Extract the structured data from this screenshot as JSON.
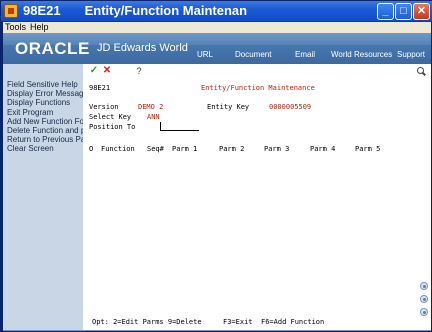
{
  "window": {
    "program": "98E21",
    "title": "Entity/Function Maintenan",
    "minimize": "_",
    "maximize": "□",
    "close": "✕"
  },
  "menubar": {
    "tools": "Tools",
    "help": "Help"
  },
  "banner": {
    "logo": "ORACLE",
    "product": "JD Edwards World",
    "links": [
      "URL",
      "Document",
      "Email",
      "World Resources",
      "Support"
    ]
  },
  "sidebar": {
    "items": [
      "Field Sensitive Help",
      "Display Error Message",
      "Display Functions",
      "Exit Program",
      "Add New Function For E",
      "Delete Function and par",
      "Return to Previous Pane",
      "Clear Screen"
    ]
  },
  "toolbar": {
    "ok": "✓",
    "cancel": "✕",
    "help": "?"
  },
  "form": {
    "program_id": "98E21",
    "heading": "Entity/Function Maintenance",
    "version_label": "Version",
    "version_value": "DEMO 2",
    "entity_key_label": "Entity Key",
    "entity_key_value": "0000005509",
    "select_key_label": "Select Key",
    "select_key_value": "ANN",
    "position_to_label": "Position To",
    "position_to_value": ""
  },
  "grid": {
    "headers": [
      "O",
      "Function",
      "Seq#",
      "Parm 1",
      "Parm 2",
      "Parm 3",
      "Parm 4",
      "Parm 5"
    ]
  },
  "footer": {
    "opt": "Opt: 2=Edit Parms  9=Delete",
    "f3": "F3=Exit",
    "f6": "F6=Add Function"
  }
}
